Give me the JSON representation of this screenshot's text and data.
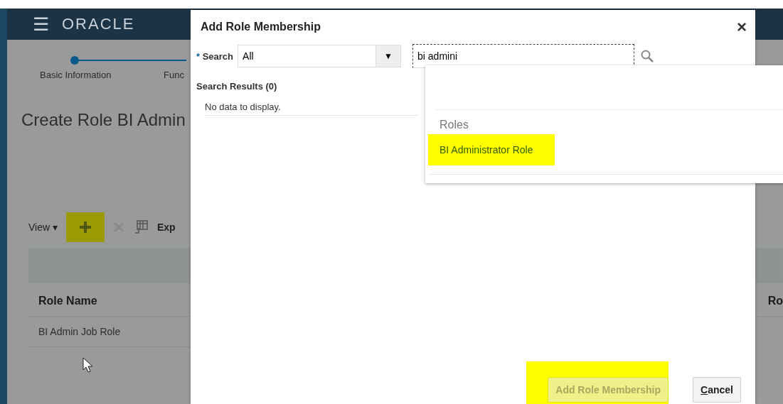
{
  "header": {
    "menu_icon": "☰",
    "brand": "ORACLE"
  },
  "train": {
    "steps": [
      {
        "label": "Basic Information",
        "selected": true
      },
      {
        "label": "Func",
        "selected": false
      }
    ]
  },
  "page": {
    "title": "Create Role BI Admin"
  },
  "toolbar": {
    "view": "View",
    "view_caret": "▾",
    "export": "Exp",
    "add_highlighted": true
  },
  "table": {
    "columns": [
      "Role Name",
      "Ro"
    ],
    "rows": [
      [
        "BI Admin Job Role"
      ]
    ]
  },
  "dialog": {
    "title": "Add Role Membership",
    "close": "×",
    "search_label": "Search",
    "required_mark": "*",
    "search_scope": "All",
    "scope_caret": "▼",
    "search_value": "bi admini",
    "results_title": "Search Results (0)",
    "empty": "No data to display.",
    "buttons": [
      {
        "label": "Add Role Membership",
        "disabled": true,
        "highlighted": true
      },
      {
        "label": "Cancel",
        "disabled": false,
        "highlighted": false
      }
    ]
  },
  "popup": {
    "group": "Roles",
    "items": [
      {
        "label": "BI Administrator Role",
        "highlighted": true
      }
    ]
  }
}
